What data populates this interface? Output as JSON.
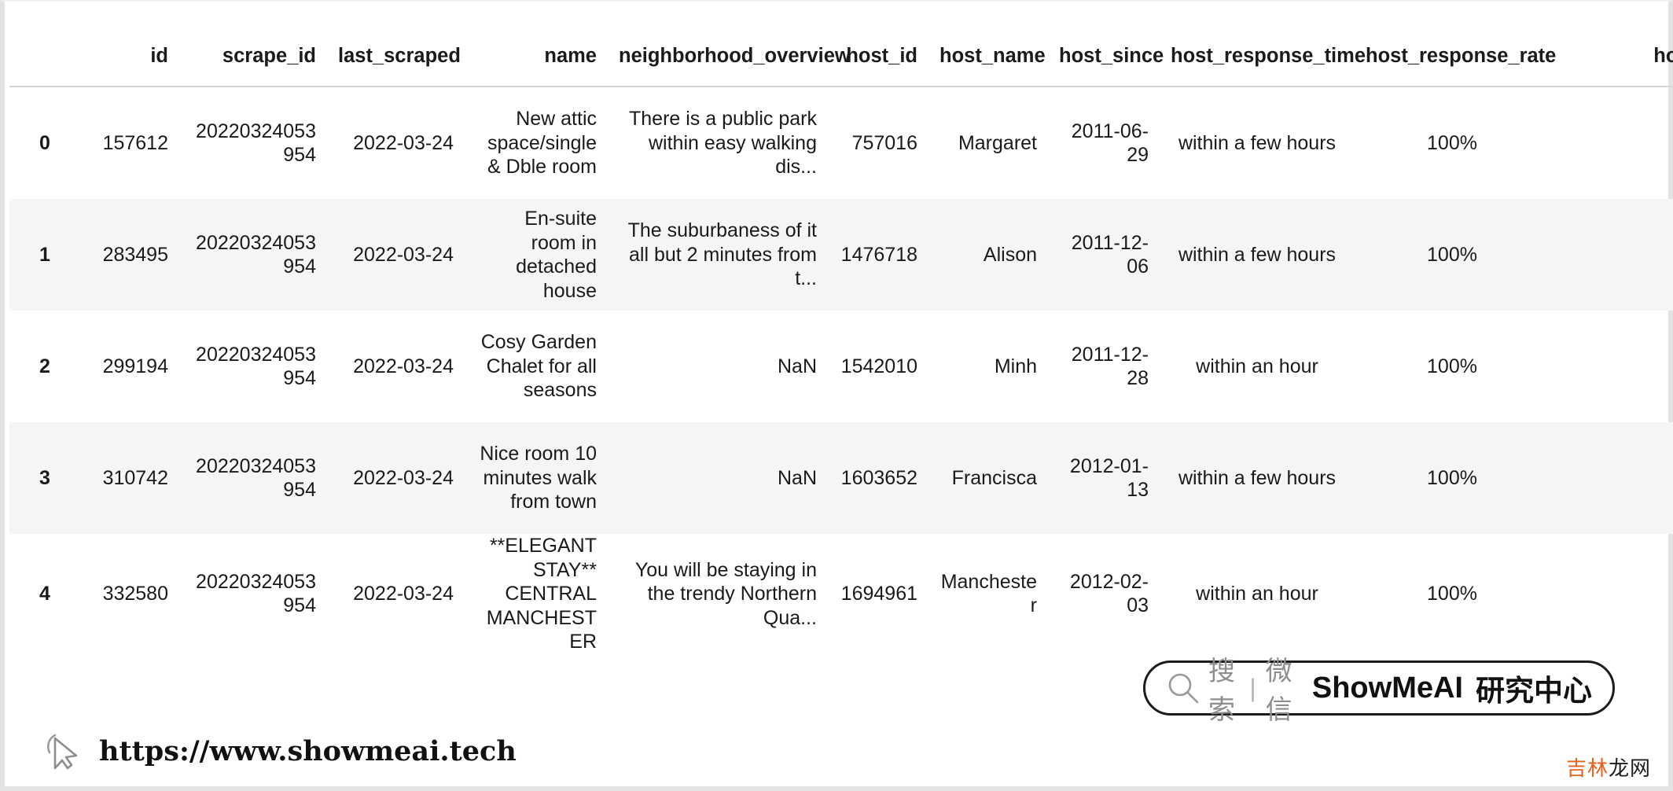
{
  "table": {
    "index_header": "",
    "columns": [
      "id",
      "scrape_id",
      "last_scraped",
      "name",
      "neighborhood_overview",
      "host_id",
      "host_name",
      "host_since",
      "host_response_time",
      "host_response_rate",
      "host_acce"
    ],
    "rows": [
      {
        "index": "0",
        "id": "157612",
        "scrape_id": "20220324053954",
        "last_scraped": "2022-03-24",
        "name": "New attic space/single & Dble room",
        "neighborhood_overview": "There is a public park within easy walking dis...",
        "host_id": "757016",
        "host_name": "Margaret",
        "host_since": "2011-06-29",
        "host_response_time": "within a few hours",
        "host_response_rate": "100%",
        "host_acce": ""
      },
      {
        "index": "1",
        "id": "283495",
        "scrape_id": "20220324053954",
        "last_scraped": "2022-03-24",
        "name": "En-suite room in detached house",
        "neighborhood_overview": "The suburbaness of it all but 2 minutes from t...",
        "host_id": "1476718",
        "host_name": "Alison",
        "host_since": "2011-12-06",
        "host_response_time": "within a few hours",
        "host_response_rate": "100%",
        "host_acce": ""
      },
      {
        "index": "2",
        "id": "299194",
        "scrape_id": "20220324053954",
        "last_scraped": "2022-03-24",
        "name": "Cosy Garden Chalet for all seasons",
        "neighborhood_overview": "NaN",
        "host_id": "1542010",
        "host_name": "Minh",
        "host_since": "2011-12-28",
        "host_response_time": "within an hour",
        "host_response_rate": "100%",
        "host_acce": ""
      },
      {
        "index": "3",
        "id": "310742",
        "scrape_id": "20220324053954",
        "last_scraped": "2022-03-24",
        "name": "Nice room 10 minutes walk from town",
        "neighborhood_overview": "NaN",
        "host_id": "1603652",
        "host_name": "Francisca",
        "host_since": "2012-01-13",
        "host_response_time": "within a few hours",
        "host_response_rate": "100%",
        "host_acce": ""
      },
      {
        "index": "4",
        "id": "332580",
        "scrape_id": "20220324053954",
        "last_scraped": "2022-03-24",
        "name": "**ELEGANT STAY** CENTRAL MANCHESTER",
        "neighborhood_overview": "You will be staying in the trendy Northern Qua...",
        "host_id": "1694961",
        "host_name": "Manchester",
        "host_since": "2012-02-03",
        "host_response_time": "within an hour",
        "host_response_rate": "100%",
        "host_acce": ""
      }
    ]
  },
  "badge": {
    "search_label": "搜索",
    "separator": "|",
    "wechat_label": "微信",
    "brand": "ShowMeAI",
    "brand_cn": "研究中心",
    "icon": "search-icon"
  },
  "footer": {
    "url": "https://www.showmeai.tech",
    "cursor_icon": "cursor-arrow-icon"
  },
  "corner_tag": {
    "text_orange": "吉林",
    "text_dark": "龙网"
  },
  "colors": {
    "page_bg": "#ffffff",
    "frame": "#e3e3e3",
    "stripe": "#f5f5f5",
    "header_rule": "#d6d6d6",
    "text": "#1a1a1a",
    "muted": "#8e8e8e",
    "accent_orange": "#e8601c"
  }
}
